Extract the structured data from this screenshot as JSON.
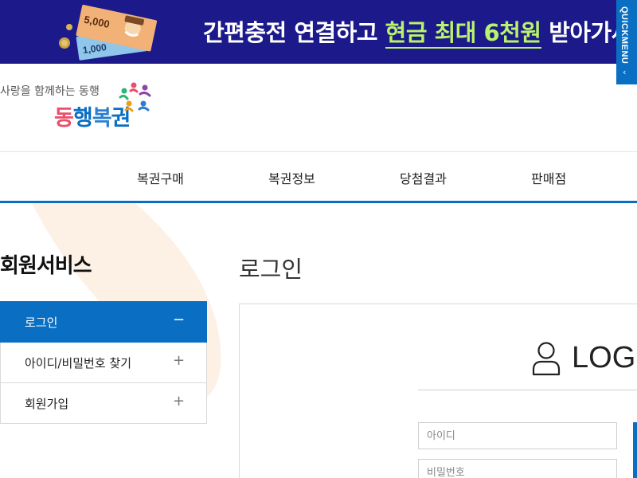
{
  "banner": {
    "text_before": "간편충전 연결하고 ",
    "text_highlight": "현금 최대 6천원",
    "text_after": " 받아가세요",
    "bill_top": "5,000",
    "bill_bottom": "1,000",
    "bg_color": "#1c1a8a",
    "highlight_color": "#b9f36b"
  },
  "quickmenu": {
    "label": "QUICKMENU",
    "chevron": "‹"
  },
  "logo": {
    "tagline": "사랑을 함께하는 동행",
    "name_parts": [
      "동",
      "행",
      "복",
      "권"
    ],
    "icon": "colorful-people-logo-icon"
  },
  "gnb": {
    "items": [
      "복권구매",
      "복권정보",
      "당첨결과",
      "판매점"
    ],
    "accent_color": "#0a6fc2"
  },
  "sidebar": {
    "title": "회원서비스",
    "items": [
      {
        "label": "로그인",
        "sign": "−",
        "active": true
      },
      {
        "label": "아이디/비밀번호 찾기",
        "sign": "+",
        "active": false
      },
      {
        "label": "회원가입",
        "sign": "+",
        "active": false
      }
    ]
  },
  "main": {
    "title": "로그인",
    "login_heading": "LOGIN",
    "user_icon": "user-icon",
    "id_placeholder": "아이디",
    "pw_placeholder": "비밀번호"
  }
}
